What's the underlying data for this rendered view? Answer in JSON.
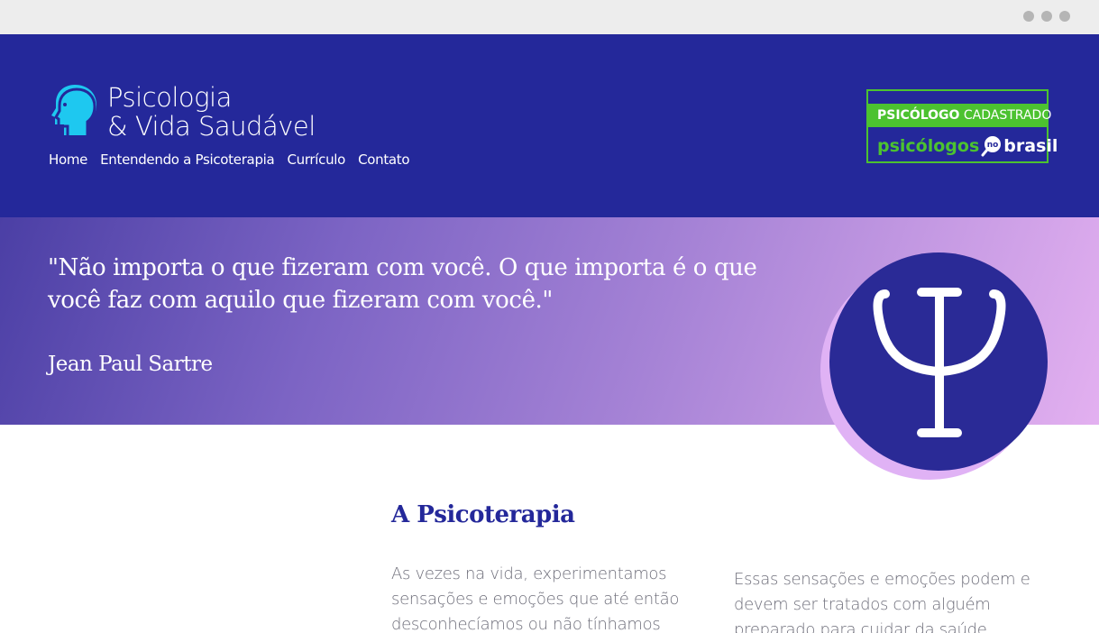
{
  "brand": {
    "line1": "Psicologia",
    "line2": "& Vida Saudável"
  },
  "nav": {
    "items": [
      {
        "label": "Home"
      },
      {
        "label": "Entendendo a Psicoterapia"
      },
      {
        "label": "Currículo"
      },
      {
        "label": "Contato"
      }
    ]
  },
  "badge": {
    "top_bold": "PSICÓLOGO",
    "top_rest": " CADASTRADO",
    "bottom_left": "psicólogos",
    "bottom_mid": "no",
    "bottom_right": "brasil"
  },
  "hero": {
    "quote": "\"Não importa o que fizeram com você. O que importa é o que você faz com aquilo que fizeram com você.\"",
    "author": "Jean Paul Sartre"
  },
  "content": {
    "title": "A Psicoterapia",
    "col1": "As vezes na vida, experimentamos sensações e emoções que até então desconhecíamos ou não tínhamos",
    "col2": "Essas sensações e emoções podem e devem ser tratados com alguém preparado para cuidar da saúde"
  },
  "colors": {
    "header": "#24289a",
    "accent_green": "#4cc230",
    "logo_cyan": "#1ec8f0",
    "psi_circle": "#2a2a96",
    "psi_shadow": "#e0b2f5"
  },
  "icons": {
    "logo": "head-profile-icon",
    "psi": "psi-symbol-icon",
    "badge": "magnifier-icon"
  }
}
